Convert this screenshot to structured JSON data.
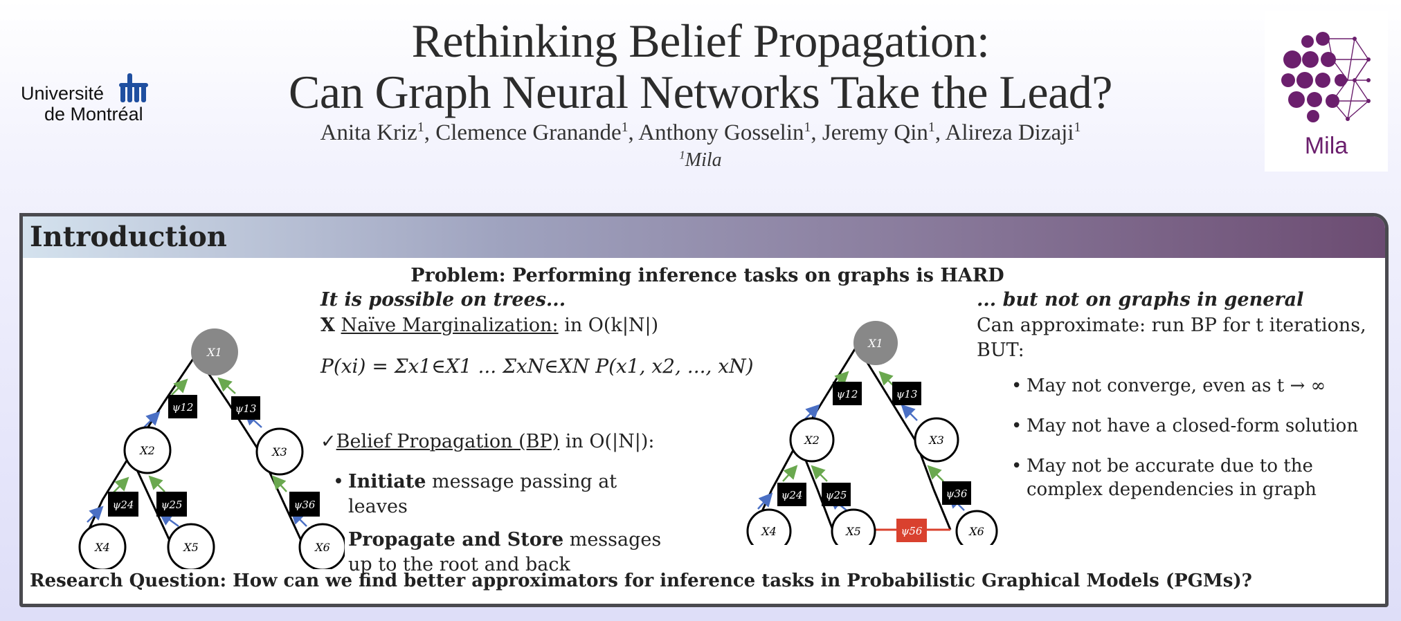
{
  "header": {
    "title_line1": "Rethinking Belief Propagation:",
    "title_line2": "Can Graph Neural Networks Take the Lead?",
    "authors": [
      {
        "name": "Anita Kriz",
        "aff": "1"
      },
      {
        "name": "Clemence Granande",
        "aff": "1"
      },
      {
        "name": "Anthony Gosselin",
        "aff": "1"
      },
      {
        "name": "Jeremy Qin",
        "aff": "1"
      },
      {
        "name": "Alireza Dizaji",
        "aff": "1"
      }
    ],
    "affiliation_mark": "1",
    "affiliation": "Mila",
    "left_logo": {
      "line1": "Université",
      "line2": "de Montréal"
    },
    "right_logo": {
      "text": "Mila"
    }
  },
  "intro": {
    "section_title": "Introduction",
    "problem": "Problem: Performing inference tasks on graphs is HARD",
    "trees_heading": "It is possible on trees...",
    "naive_mark": "X",
    "naive_label": "Naïve Marginalization:",
    "naive_tail": "in O(k|N|)",
    "formula": "P(xi) = Σx1∈X1 ... ΣxN∈XN P(x1, x2, ..., xN)",
    "bp_mark": "✓",
    "bp_label": "Belief Propagation (BP)",
    "bp_tail": "in O(|N|):",
    "bullets": [
      {
        "bold": "Initiate",
        "rest": "message passing at leaves"
      },
      {
        "bold": "Propagate and Store",
        "rest": "messages up to the root and back"
      }
    ],
    "general_heading": "... but not on graphs in general",
    "approx_text": "Can approximate: run BP for t iterations, BUT:",
    "right_bullets": [
      "May not converge, even as t → ∞",
      "May not have a closed-form solution",
      "May not be accurate due to the complex dependencies in graph"
    ],
    "research_question": "Research Question: How can we find better approximators for inference tasks in Probabilistic Graphical Models (PGMs)?"
  },
  "tree_left": {
    "nodes": [
      "X1",
      "X2",
      "X3",
      "X4",
      "X5",
      "X6"
    ],
    "factors": [
      "ψ12",
      "ψ13",
      "ψ24",
      "ψ25",
      "ψ36"
    ]
  },
  "tree_right": {
    "nodes": [
      "X1",
      "X2",
      "X3",
      "X4",
      "X5",
      "X6"
    ],
    "factors": [
      "ψ12",
      "ψ13",
      "ψ24",
      "ψ25",
      "ψ36",
      "ψ56"
    ]
  },
  "colors": {
    "root": "#888888",
    "factor": "#000000",
    "loop_factor": "#d9412e",
    "arrow_up": "#6aa84f",
    "arrow_down": "#4a6fc4",
    "logo_purple": "#6b1f6d",
    "logo_blue": "#1f4fa0"
  }
}
